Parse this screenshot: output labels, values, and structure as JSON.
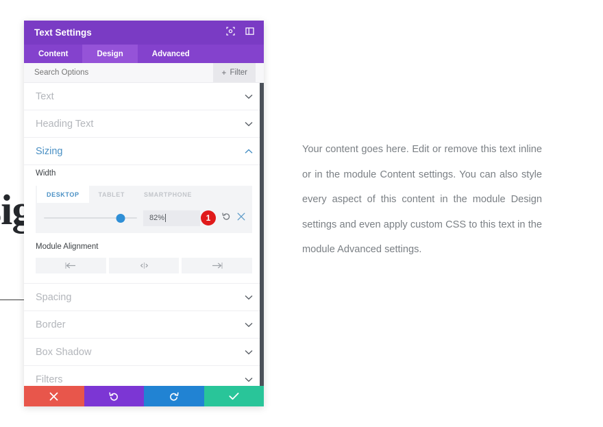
{
  "background": {
    "heading_partial": "sig",
    "body_paragraph": "Your content goes here. Edit or remove this text inline or in the module Content settings. You can also style every aspect of this content in the module Design settings and even apply custom CSS to this text in the module Advanced settings."
  },
  "panel": {
    "title": "Text Settings",
    "header_icons": [
      {
        "name": "focus-target-icon"
      },
      {
        "name": "layout-panel-icon"
      }
    ],
    "tabs": [
      {
        "label": "Content",
        "active": false
      },
      {
        "label": "Design",
        "active": true
      },
      {
        "label": "Advanced",
        "active": false
      }
    ],
    "search": {
      "placeholder": "Search Options",
      "value": ""
    },
    "filter_button": {
      "label": "Filter",
      "plus": "+"
    },
    "sections": [
      {
        "label": "Text",
        "open": false
      },
      {
        "label": "Heading Text",
        "open": false
      },
      {
        "label": "Sizing",
        "open": true
      },
      {
        "label": "Spacing",
        "open": false
      },
      {
        "label": "Border",
        "open": false
      },
      {
        "label": "Box Shadow",
        "open": false
      },
      {
        "label": "Filters",
        "open": false
      }
    ],
    "sizing": {
      "width_label": "Width",
      "responsive_tabs": [
        {
          "label": "DESKTOP",
          "active": true
        },
        {
          "label": "TABLET",
          "active": false
        },
        {
          "label": "SMARTPHONE",
          "active": false
        }
      ],
      "slider": {
        "value_text": "82%",
        "percent": 82
      },
      "badge_number": "1",
      "reset_icon": "reset-arrow-icon",
      "clear_icon": "close-x-icon",
      "alignment_label": "Module Alignment",
      "alignment_buttons": [
        {
          "name": "align-left-icon"
        },
        {
          "name": "align-center-icon"
        },
        {
          "name": "align-right-icon"
        }
      ]
    },
    "footer_buttons": [
      {
        "name": "cancel-button",
        "icon": "x-icon",
        "color": "#e8564b"
      },
      {
        "name": "undo-button",
        "icon": "undo-arrow-icon",
        "color": "#7c36d4"
      },
      {
        "name": "redo-button",
        "icon": "redo-arrow-icon",
        "color": "#2183d3"
      },
      {
        "name": "save-button",
        "icon": "check-icon",
        "color": "#29c599"
      }
    ]
  },
  "colors": {
    "header_purple": "#7a3bc4",
    "tabs_purple": "#8442cd",
    "active_tab_purple": "#9553d8",
    "accent_blue": "#2f8fd6",
    "badge_red": "#e01b1b"
  }
}
